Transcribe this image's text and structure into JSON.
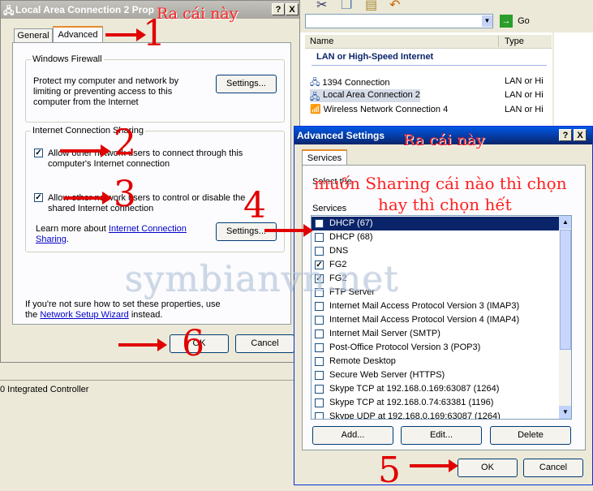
{
  "background_window": {
    "goto_label": "Go",
    "columns": [
      "Name",
      "Type"
    ],
    "group_header": "LAN or High-Speed Internet",
    "rows": [
      {
        "name": "1394 Connection",
        "type": "LAN or Hi"
      },
      {
        "name": "Local Area Connection 2",
        "type": "LAN or Hi"
      },
      {
        "name": "Wireless Network Connection 4",
        "type": "LAN or Hi"
      }
    ],
    "status_text": "0 Integrated Controller"
  },
  "properties_dialog": {
    "title": "Local Area Connection 2 Prop",
    "help_btn": "?",
    "close_btn": "X",
    "tabs": [
      "General",
      "Advanced"
    ],
    "firewall": {
      "legend": "Windows Firewall",
      "text": "Protect my computer and network by limiting or preventing access to this computer from the Internet",
      "button": "Settings..."
    },
    "sharing": {
      "legend": "Internet Connection Sharing",
      "option1_start": "Allow other",
      "option1_mid": "network users to connect through this",
      "option1_end": "computer's Internet connection",
      "option2_start": "Allow other",
      "option2_mid": "network users to control or disable the",
      "option2_end": "shared Internet connection",
      "learn_prefix": "Learn more about",
      "learn_link1": "Internet Connection",
      "learn_link2": "Sharing",
      "button": "Settings..."
    },
    "wizard_line1": "If you're not sure how to set these properties, use",
    "wizard_prefix": "the",
    "wizard_link": "Network Setup Wizard",
    "wizard_suffix": "instead.",
    "ok": "OK",
    "cancel": "Cancel"
  },
  "advanced_dialog": {
    "title": "Advanced Settings",
    "help_btn": "?",
    "close_btn": "X",
    "tab": "Services",
    "select_text": "Select the",
    "services_label": "Services",
    "services": [
      {
        "label": "DHCP (67)",
        "checked": false,
        "selected": true
      },
      {
        "label": "DHCP (68)",
        "checked": false
      },
      {
        "label": "DNS",
        "checked": false
      },
      {
        "label": "FG2",
        "checked": true
      },
      {
        "label": "FG2",
        "checked": true
      },
      {
        "label": "FTP Server",
        "checked": false
      },
      {
        "label": "Internet Mail Access Protocol Version 3 (IMAP3)",
        "checked": false
      },
      {
        "label": "Internet Mail Access Protocol Version 4 (IMAP4)",
        "checked": false
      },
      {
        "label": "Internet Mail Server (SMTP)",
        "checked": false
      },
      {
        "label": "Post-Office Protocol Version 3 (POP3)",
        "checked": false
      },
      {
        "label": "Remote Desktop",
        "checked": false
      },
      {
        "label": "Secure Web Server (HTTPS)",
        "checked": false
      },
      {
        "label": "Skype TCP at 192.168.0.169:63087 (1264)",
        "checked": false
      },
      {
        "label": "Skype TCP at 192.168.0.74:63381 (1196)",
        "checked": false
      },
      {
        "label": "Skype UDP at 192.168.0.169:63087 (1264)",
        "checked": false
      }
    ],
    "add": "Add...",
    "edit": "Edit...",
    "delete": "Delete",
    "ok": "OK",
    "cancel": "Cancel"
  },
  "annotations": {
    "ra_cai_nay_1": "Ra cái này",
    "ra_cai_nay_2": "Ra cái này",
    "hint_line1": "muốn Sharing cái nào thì chọn",
    "hint_line2": "hay thì chọn hết",
    "watermark": "symbianvn.net",
    "n1": "1",
    "n2": "2",
    "n3": "3",
    "n4": "4",
    "n5": "5",
    "n6": "6"
  }
}
